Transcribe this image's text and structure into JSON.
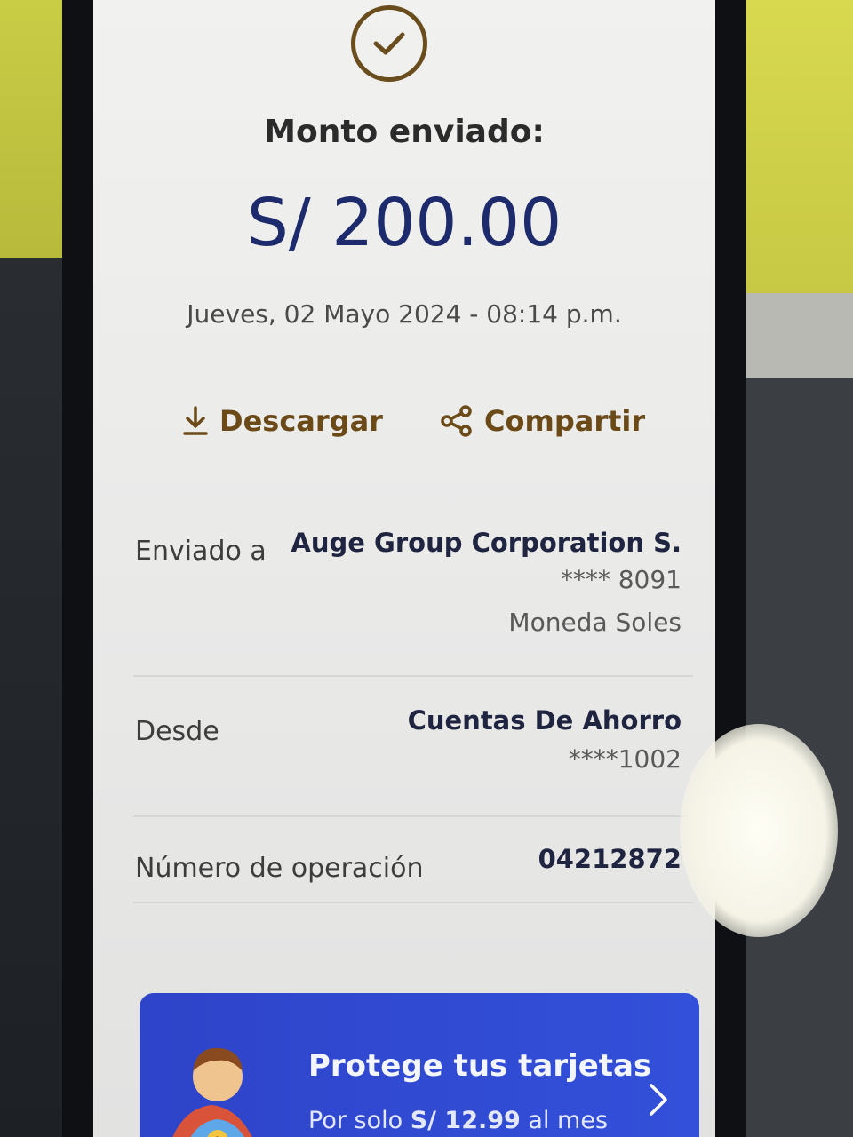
{
  "receipt": {
    "title": "Monto enviado:",
    "amount": "S/ 200.00",
    "datetime": "Jueves, 02 Mayo 2024 - 08:14 p.m."
  },
  "actions": {
    "download_label": "Descargar",
    "share_label": "Compartir"
  },
  "details": {
    "sent_to": {
      "label": "Enviado a",
      "name": "Auge Group Corporation S.",
      "account": "**** 8091",
      "currency": "Moneda Soles"
    },
    "from": {
      "label": "Desde",
      "account_type": "Cuentas De Ahorro",
      "account": "****1002"
    },
    "operation": {
      "label": "Número de operación",
      "number": "04212872"
    }
  },
  "promo": {
    "title": "Protege tus tarjetas",
    "subtitle_prefix": "Por solo ",
    "subtitle_price": "S/ 12.99",
    "subtitle_suffix": " al mes"
  },
  "colors": {
    "brand_blue": "#1d2a6b",
    "accent_brown": "#6b4a17",
    "promo_blue": "#3350da"
  },
  "icons": {
    "status": "check-circle-icon",
    "download": "download-icon",
    "share": "share-icon",
    "promo_arrow": "chevron-right-icon"
  }
}
